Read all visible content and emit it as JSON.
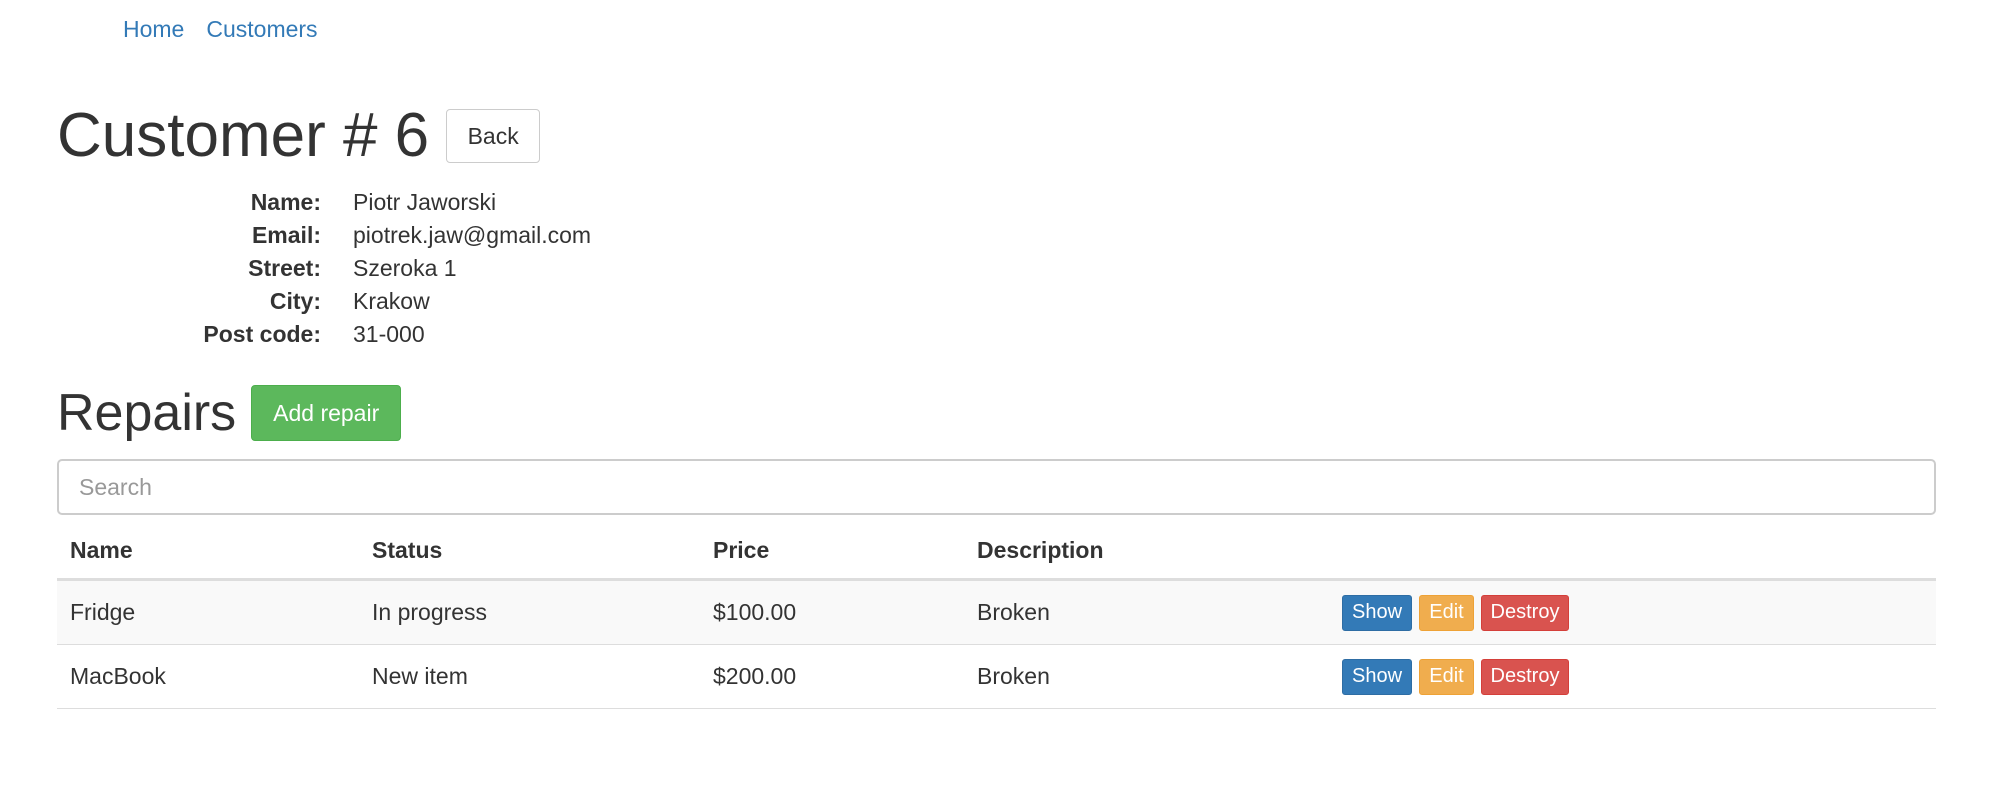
{
  "nav": {
    "links": [
      "Home",
      "Customers"
    ]
  },
  "page": {
    "title": "Customer # 6",
    "back_label": "Back"
  },
  "customer": {
    "fields": [
      {
        "label": "Name:",
        "value": "Piotr Jaworski"
      },
      {
        "label": "Email:",
        "value": "piotrek.jaw@gmail.com"
      },
      {
        "label": "Street:",
        "value": "Szeroka 1"
      },
      {
        "label": "City:",
        "value": "Krakow"
      },
      {
        "label": "Post code:",
        "value": "31-000"
      }
    ]
  },
  "repairs": {
    "title": "Repairs",
    "add_label": "Add repair",
    "search_placeholder": "Search",
    "columns": [
      "Name",
      "Status",
      "Price",
      "Description"
    ],
    "rows": [
      {
        "name": "Fridge",
        "status": "In progress",
        "price": "$100.00",
        "description": "Broken"
      },
      {
        "name": "MacBook",
        "status": "New item",
        "price": "$200.00",
        "description": "Broken"
      }
    ],
    "actions": {
      "show": "Show",
      "edit": "Edit",
      "destroy": "Destroy"
    }
  },
  "colors": {
    "link": "#337ab7",
    "primary": "#337ab7",
    "success": "#5cb85c",
    "warning": "#f0ad4e",
    "danger": "#d9534f"
  }
}
